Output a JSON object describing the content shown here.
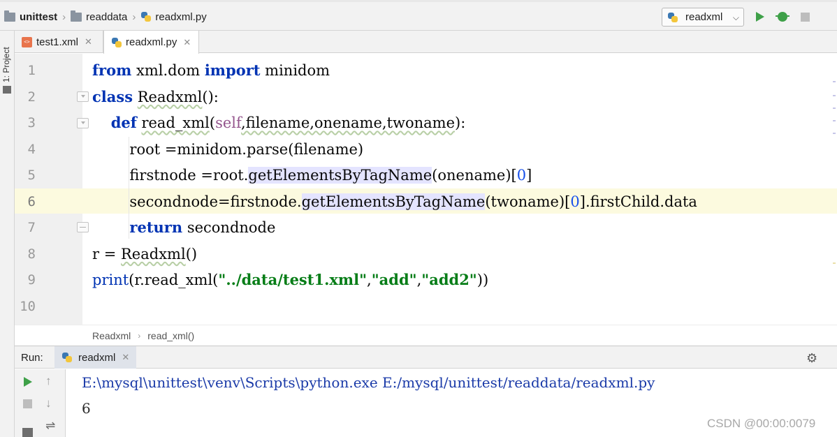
{
  "breadcrumbs": [
    "unittest",
    "readdata",
    "readxml.py"
  ],
  "run_config": {
    "label": "readxml"
  },
  "left_tool": {
    "label": "1: Project"
  },
  "tabs": [
    {
      "label": "test1.xml",
      "icon": "xml-file-icon",
      "active": false
    },
    {
      "label": "readxml.py",
      "icon": "python-file-icon",
      "active": true
    }
  ],
  "editor": {
    "line_numbers": [
      "1",
      "2",
      "3",
      "4",
      "5",
      "6",
      "7",
      "8",
      "9",
      "10"
    ],
    "current_line": "6",
    "lines": [
      [
        {
          "t": "from",
          "c": "kw"
        },
        {
          "t": " xml.dom "
        },
        {
          "t": "import",
          "c": "kw"
        },
        {
          "t": " minidom"
        }
      ],
      [
        {
          "t": "class",
          "c": "kw"
        },
        {
          "t": " "
        },
        {
          "t": "Readxml",
          "c": "squig"
        },
        {
          "t": "():"
        }
      ],
      [
        {
          "t": "    "
        },
        {
          "t": "def",
          "c": "kw"
        },
        {
          "t": " "
        },
        {
          "t": "read_xml",
          "c": "squig"
        },
        {
          "t": "("
        },
        {
          "t": "self",
          "c": "selfkw"
        },
        {
          "t": ",filename,onename,twoname",
          "c": "squig"
        },
        {
          "t": "):"
        }
      ],
      [
        {
          "t": "        root =minidom.parse(filename)"
        }
      ],
      [
        {
          "t": "        firstnode =root."
        },
        {
          "t": "getElementsByTagName",
          "c": "hlmethod"
        },
        {
          "t": "(onename)["
        },
        {
          "t": "0",
          "c": "num"
        },
        {
          "t": "]"
        }
      ],
      [
        {
          "t": "        secondnode=firstnode."
        },
        {
          "t": "getElementsByTagName",
          "c": "hlmethod"
        },
        {
          "t": "(twoname)["
        },
        {
          "t": "0",
          "c": "num"
        },
        {
          "t": "].firstChild.data"
        }
      ],
      [
        {
          "t": "        "
        },
        {
          "t": "return",
          "c": "kw"
        },
        {
          "t": " secondnode"
        }
      ],
      [
        {
          "t": "r = "
        },
        {
          "t": "Readxml",
          "c": "squig"
        },
        {
          "t": "()"
        }
      ],
      [
        {
          "t": "print",
          "c": "kw-print"
        },
        {
          "t": "(r.read_xml("
        },
        {
          "t": "\"../data/test1.xml\"",
          "c": "str"
        },
        {
          "t": ","
        },
        {
          "t": "\"add\"",
          "c": "str"
        },
        {
          "t": ","
        },
        {
          "t": "\"add2\"",
          "c": "str"
        },
        {
          "t": "))"
        }
      ],
      []
    ]
  },
  "editor_breadcrumb": [
    "Readxml",
    "read_xml()"
  ],
  "run_panel": {
    "label": "Run:",
    "tab_label": "readxml",
    "output_lines": [
      "E:\\mysql\\unittest\\venv\\Scripts\\python.exe E:/mysql/unittest/readdata/readxml.py",
      "6"
    ]
  },
  "watermark": "CSDN @00:00:0079",
  "colors": {
    "keyword": "#0033b3",
    "string": "#067d17",
    "number": "#1750eb",
    "self": "#94558d",
    "current_line": "#fcfadf",
    "run_green": "#3ea048"
  }
}
